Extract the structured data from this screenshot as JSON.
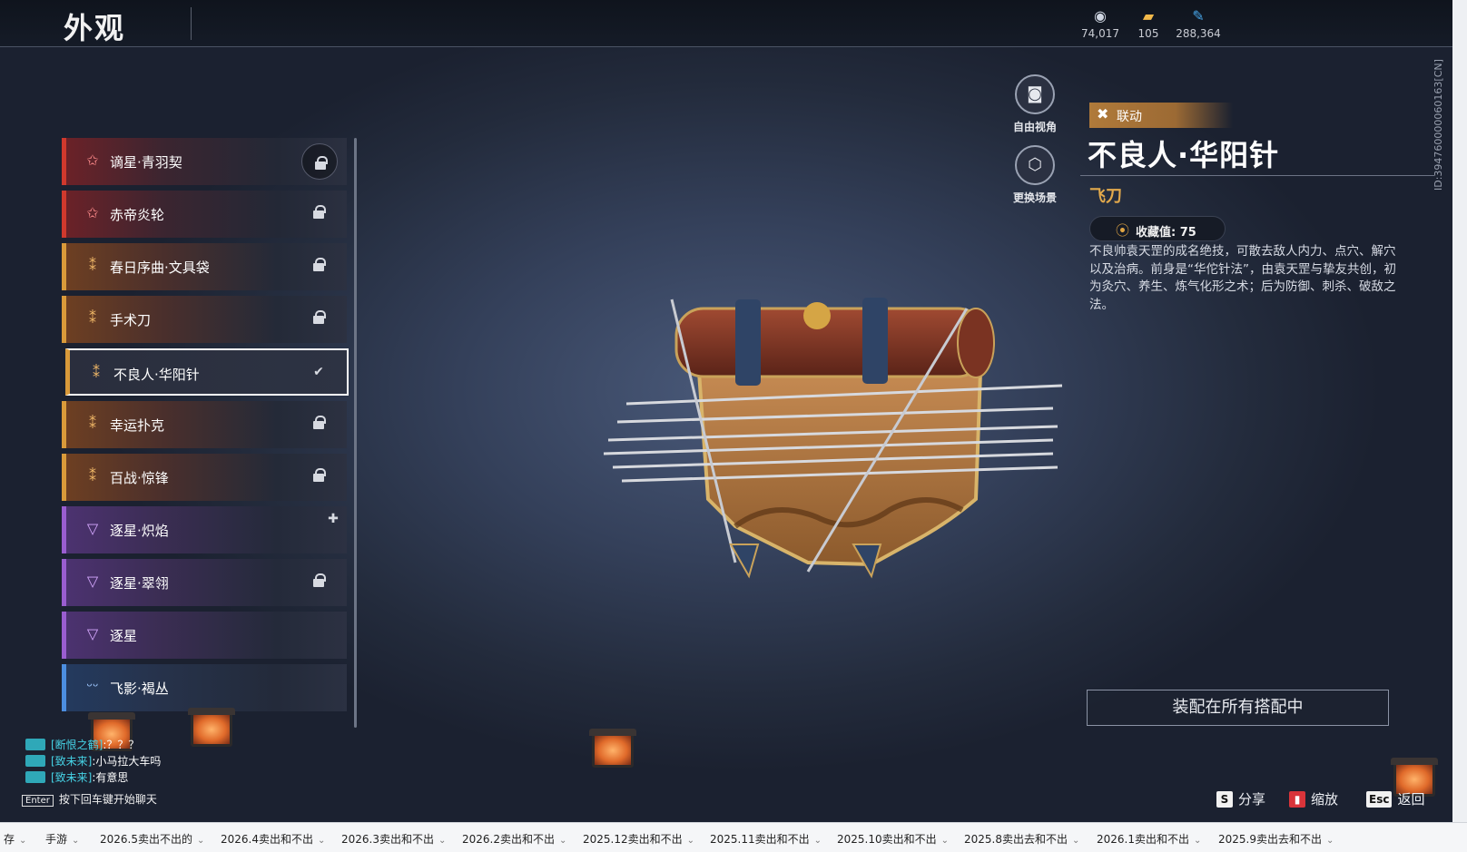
{
  "header": {
    "title": "外观",
    "currencies": [
      {
        "icon": "jade-icon",
        "value": "74,017"
      },
      {
        "icon": "ticket-icon",
        "value": "105"
      },
      {
        "icon": "feather-icon",
        "value": "288,364"
      }
    ]
  },
  "list": {
    "items": [
      {
        "label": "谪星·青羽契",
        "rank": "red",
        "state": "locked-circle"
      },
      {
        "label": "赤帝炎轮",
        "rank": "red",
        "state": "locked"
      },
      {
        "label": "春日序曲·文具袋",
        "rank": "gold",
        "state": "locked"
      },
      {
        "label": "手术刀",
        "rank": "gold",
        "state": "locked"
      },
      {
        "label": "不良人·华阳针",
        "rank": "gold",
        "state": "equipped"
      },
      {
        "label": "幸运扑克",
        "rank": "gold",
        "state": "locked"
      },
      {
        "label": "百战·惊锋",
        "rank": "gold",
        "state": "locked"
      },
      {
        "label": "逐星·炽焰",
        "rank": "purple",
        "state": "new"
      },
      {
        "label": "逐星·翠翎",
        "rank": "purple",
        "state": "locked"
      },
      {
        "label": "逐星",
        "rank": "purple",
        "state": "none"
      },
      {
        "label": "飞影·褐丛",
        "rank": "blue",
        "state": "none"
      }
    ]
  },
  "tools": {
    "free_view": "自由视角",
    "change_scene": "更换场景"
  },
  "detail": {
    "tag": "联动",
    "name": "不良人·华阳针",
    "type": "飞刀",
    "collect_label": "收藏值: 75",
    "description": "不良帅袁天罡的成名绝技，可散去敌人内力、点穴、解穴以及治病。前身是“华佗针法”，由袁天罡与挚友共创，初为灸穴、养生、炼气化形之术；后为防御、刺杀、破敌之法。",
    "equip_button": "装配在所有搭配中"
  },
  "hints": {
    "share_key": "S",
    "share": "分享",
    "zoom": "缩放",
    "back_key": "Esc",
    "back": "返回"
  },
  "chat": {
    "lines": [
      {
        "name": "[断恨之鹤]",
        "msg": ":？？？"
      },
      {
        "name": "[致未来]",
        "msg": ":小马拉大车吗"
      },
      {
        "name": "[致未来]",
        "msg": ":有意思"
      }
    ],
    "enter_key": "Enter",
    "enter_hint": "按下回车键开始聊天"
  },
  "overlay_id": "ID:394760000060163[CN]",
  "bookmarks": [
    "存",
    "手游",
    "2026.5卖出不出的",
    "2026.4卖出和不出",
    "2026.3卖出和不出",
    "2026.2卖出和不出",
    "2025.12卖出和不出",
    "2025.11卖出和不出",
    "2025.10卖出和不出",
    "2025.8卖出去和不出",
    "2026.1卖出和不出",
    "2025.9卖出去和不出"
  ]
}
